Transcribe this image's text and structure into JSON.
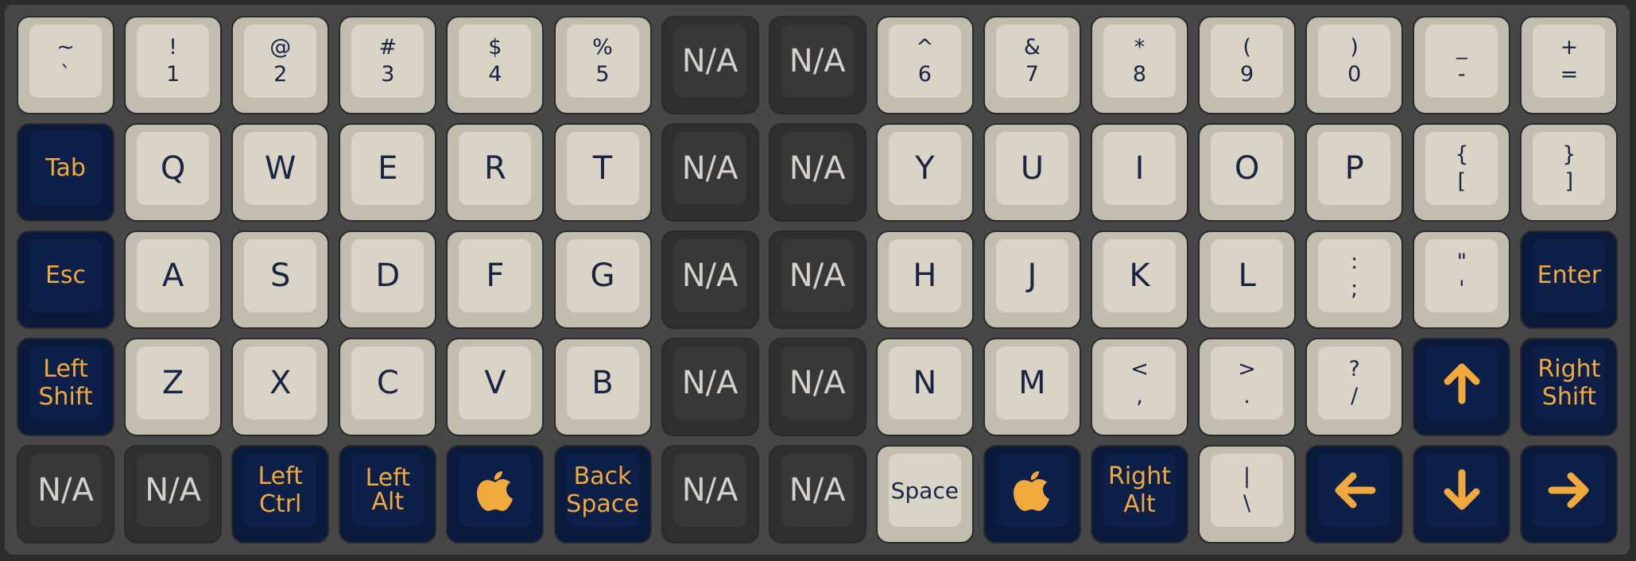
{
  "colors": {
    "light_keycap": "#d9d4c5",
    "dark_keycap": "#383838",
    "navy_keycap": "#0d2049",
    "legend_navy": "#1a2546",
    "legend_orange": "#f2a93b",
    "case": "#474747"
  },
  "rows": [
    [
      {
        "style": "light",
        "top": "~",
        "bottom": "`"
      },
      {
        "style": "light",
        "top": "!",
        "bottom": "1"
      },
      {
        "style": "light",
        "top": "@",
        "bottom": "2"
      },
      {
        "style": "light",
        "top": "#",
        "bottom": "3"
      },
      {
        "style": "light",
        "top": "$",
        "bottom": "4"
      },
      {
        "style": "light",
        "top": "%",
        "bottom": "5"
      },
      {
        "style": "dark",
        "label": "N/A"
      },
      {
        "style": "dark",
        "label": "N/A"
      },
      {
        "style": "light",
        "top": "^",
        "bottom": "6"
      },
      {
        "style": "light",
        "top": "&",
        "bottom": "7"
      },
      {
        "style": "light",
        "top": "*",
        "bottom": "8"
      },
      {
        "style": "light",
        "top": "(",
        "bottom": "9"
      },
      {
        "style": "light",
        "top": ")",
        "bottom": "0"
      },
      {
        "style": "light",
        "top": "_",
        "bottom": "-"
      },
      {
        "style": "light",
        "top": "+",
        "bottom": "="
      }
    ],
    [
      {
        "style": "navy",
        "label": "Tab"
      },
      {
        "style": "light",
        "label": "Q"
      },
      {
        "style": "light",
        "label": "W"
      },
      {
        "style": "light",
        "label": "E"
      },
      {
        "style": "light",
        "label": "R"
      },
      {
        "style": "light",
        "label": "T"
      },
      {
        "style": "dark",
        "label": "N/A"
      },
      {
        "style": "dark",
        "label": "N/A"
      },
      {
        "style": "light",
        "label": "Y"
      },
      {
        "style": "light",
        "label": "U"
      },
      {
        "style": "light",
        "label": "I"
      },
      {
        "style": "light",
        "label": "O"
      },
      {
        "style": "light",
        "label": "P"
      },
      {
        "style": "light",
        "top": "{",
        "bottom": "["
      },
      {
        "style": "light",
        "top": "}",
        "bottom": "]"
      }
    ],
    [
      {
        "style": "navy",
        "label": "Esc"
      },
      {
        "style": "light",
        "label": "A"
      },
      {
        "style": "light",
        "label": "S"
      },
      {
        "style": "light",
        "label": "D"
      },
      {
        "style": "light",
        "label": "F"
      },
      {
        "style": "light",
        "label": "G"
      },
      {
        "style": "dark",
        "label": "N/A"
      },
      {
        "style": "dark",
        "label": "N/A"
      },
      {
        "style": "light",
        "label": "H"
      },
      {
        "style": "light",
        "label": "J"
      },
      {
        "style": "light",
        "label": "K"
      },
      {
        "style": "light",
        "label": "L"
      },
      {
        "style": "light",
        "top": ":",
        "bottom": ";"
      },
      {
        "style": "light",
        "top": "\"",
        "bottom": "'"
      },
      {
        "style": "navy",
        "label": "Enter"
      }
    ],
    [
      {
        "style": "navy",
        "top": "Left",
        "bottom": "Shift"
      },
      {
        "style": "light",
        "label": "Z"
      },
      {
        "style": "light",
        "label": "X"
      },
      {
        "style": "light",
        "label": "C"
      },
      {
        "style": "light",
        "label": "V"
      },
      {
        "style": "light",
        "label": "B"
      },
      {
        "style": "dark",
        "label": "N/A"
      },
      {
        "style": "dark",
        "label": "N/A"
      },
      {
        "style": "light",
        "label": "N"
      },
      {
        "style": "light",
        "label": "M"
      },
      {
        "style": "light",
        "top": "<",
        "bottom": ","
      },
      {
        "style": "light",
        "top": ">",
        "bottom": "."
      },
      {
        "style": "light",
        "top": "?",
        "bottom": "/"
      },
      {
        "style": "navy",
        "icon": "arrow-up-icon"
      },
      {
        "style": "navy",
        "top": "Right",
        "bottom": "Shift"
      }
    ],
    [
      {
        "style": "dark",
        "label": "N/A"
      },
      {
        "style": "dark",
        "label": "N/A"
      },
      {
        "style": "navy",
        "top": "Left",
        "bottom": "Ctrl"
      },
      {
        "style": "navy",
        "label": "Left Alt"
      },
      {
        "style": "navy",
        "icon": "apple-icon"
      },
      {
        "style": "navy",
        "top": "Back",
        "bottom": "Space"
      },
      {
        "style": "dark",
        "label": "N/A"
      },
      {
        "style": "dark",
        "label": "N/A"
      },
      {
        "style": "light",
        "label": "Space"
      },
      {
        "style": "navy",
        "icon": "apple-icon"
      },
      {
        "style": "navy",
        "top": "Right",
        "bottom": "Alt"
      },
      {
        "style": "light",
        "top": "|",
        "bottom": "\\"
      },
      {
        "style": "navy",
        "icon": "arrow-left-icon"
      },
      {
        "style": "navy",
        "icon": "arrow-down-icon"
      },
      {
        "style": "navy",
        "icon": "arrow-right-icon"
      }
    ]
  ]
}
